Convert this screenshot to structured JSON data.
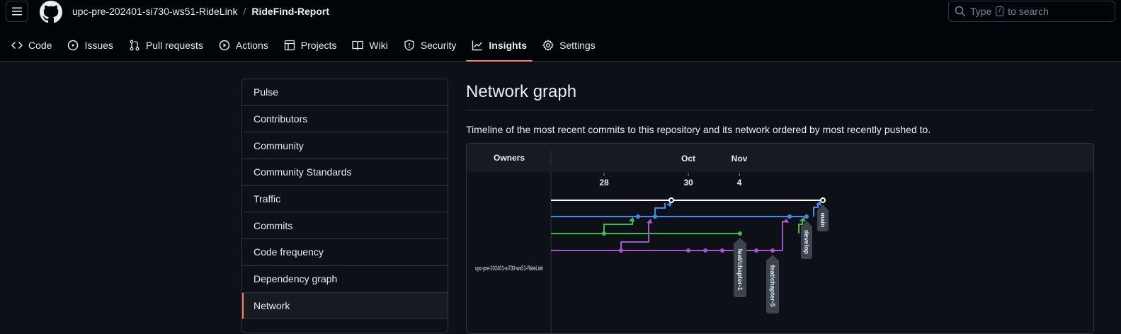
{
  "header": {
    "owner": "upc-pre-202401-si730-ws51-RideLink",
    "separator": "/",
    "repo": "RideFind-Report",
    "search_prefix": "Type",
    "search_key": "/",
    "search_suffix": "to search"
  },
  "tabs": [
    {
      "label": "Code",
      "icon": "code-icon"
    },
    {
      "label": "Issues",
      "icon": "issue-icon"
    },
    {
      "label": "Pull requests",
      "icon": "pull-request-icon"
    },
    {
      "label": "Actions",
      "icon": "play-icon"
    },
    {
      "label": "Projects",
      "icon": "table-icon"
    },
    {
      "label": "Wiki",
      "icon": "book-icon"
    },
    {
      "label": "Security",
      "icon": "shield-icon"
    },
    {
      "label": "Insights",
      "icon": "graph-icon",
      "active": true
    },
    {
      "label": "Settings",
      "icon": "gear-icon"
    }
  ],
  "sidebar": {
    "items": [
      {
        "label": "Pulse"
      },
      {
        "label": "Contributors"
      },
      {
        "label": "Community"
      },
      {
        "label": "Community Standards"
      },
      {
        "label": "Traffic"
      },
      {
        "label": "Commits"
      },
      {
        "label": "Code frequency"
      },
      {
        "label": "Dependency graph"
      },
      {
        "label": "Network",
        "active": true
      }
    ]
  },
  "main": {
    "title": "Network graph",
    "description": "Timeline of the most recent commits to this repository and its network ordered by most recently pushed to."
  },
  "network": {
    "owners_label": "Owners",
    "owner_row": "upc-pre-202401-si730-ws51-RideLink",
    "months": [
      "Oct",
      "Nov"
    ],
    "days": [
      "28",
      "30",
      "4"
    ],
    "branches": [
      {
        "name": "main",
        "color": "#ffffff"
      },
      {
        "name": "develop",
        "color": "#3b8eea"
      },
      {
        "name": "feat/chapter-1",
        "color": "#3fb950"
      },
      {
        "name": "feat/chapter-5",
        "color": "#a855c7"
      }
    ]
  },
  "colors": {
    "accent_underline": "#f78166",
    "background": "#0d1117",
    "header_bg": "#010409",
    "border": "#30363d"
  }
}
